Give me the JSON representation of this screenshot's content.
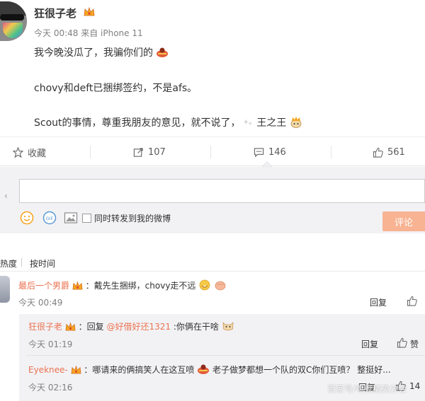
{
  "post": {
    "username": "狂很子老",
    "meta": "今天 00:48 来自 iPhone 11",
    "line1": "我今晚没瓜了，我骗你们的",
    "line2": "chovy和deft已捆绑签约，不是afs。",
    "line3_a": "Scout的事情，尊重我朋友的意见，就不说了，",
    "line3_b": "王之王"
  },
  "actions": {
    "favorite": "收藏",
    "repost": "107",
    "comment": "146",
    "like": "561"
  },
  "composer": {
    "left_arrow": "‹",
    "repost_label": "同时转发到我的微博",
    "submit": "评论"
  },
  "sort": {
    "hot": "热度",
    "time": "按时间"
  },
  "comments": {
    "c1": {
      "user": "最后一个男爵",
      "text": "：戴先生捆绑，chovy走不远",
      "time": "今天 00:49",
      "reply": "回复"
    },
    "r1": {
      "user": "狂很子老",
      "prefix": "：回复",
      "mention": "@好借好还1321",
      "text": ":你俩在干啥",
      "time": "今天 01:19",
      "reply": "回复",
      "like": "赞"
    },
    "r2": {
      "user": "Eyeknee-",
      "text_a": "：哪请来的俩搞笑人在这互喷",
      "text_b": "老子做梦都想一个队的双C你们互喷？ 整挺好...",
      "time": "今天 02:16",
      "reply": "回复",
      "like": "14"
    }
  },
  "watermark": "百家号/电竞精英分会",
  "colors": {
    "accent": "#eb7350",
    "submit_bg": "#f7b392",
    "panel": "#f2f2f5"
  }
}
